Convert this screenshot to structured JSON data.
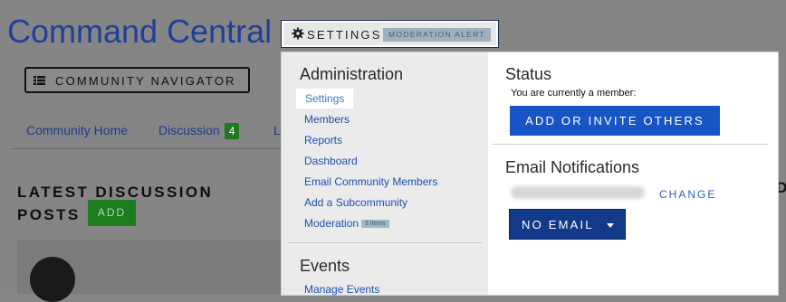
{
  "header": {
    "title": "Command Central"
  },
  "settings_button": {
    "label": "SETTINGS",
    "alert": "MODERATION ALERT",
    "icon": "gear-icon"
  },
  "navigator": {
    "label": "COMMUNITY NAVIGATOR",
    "icon": "list-icon"
  },
  "tabs": [
    {
      "label": "Community Home"
    },
    {
      "label": "Discussion",
      "count": "4"
    },
    {
      "label": "L"
    }
  ],
  "latest": {
    "title_line1": "LATEST DISCUSSION",
    "title_line2": "POSTS",
    "add_label": "ADD"
  },
  "right_fragment": "D",
  "dropdown": {
    "administration": {
      "heading": "Administration",
      "items": [
        {
          "label": "Settings"
        },
        {
          "label": "Members"
        },
        {
          "label": "Reports"
        },
        {
          "label": "Dashboard"
        },
        {
          "label": "Email Community Members"
        },
        {
          "label": "Add a Subcommunity"
        },
        {
          "label": "Moderation",
          "badge": "3 items"
        }
      ]
    },
    "events": {
      "heading": "Events",
      "items": [
        {
          "label": "Manage Events"
        }
      ]
    },
    "status": {
      "heading": "Status",
      "text": "You are currently a member:",
      "button": "ADD OR INVITE OTHERS"
    },
    "email": {
      "heading": "Email Notifications",
      "change": "CHANGE",
      "button": "NO EMAIL"
    }
  },
  "colors": {
    "accent_blue": "#1755c5",
    "green": "#1f7a1f",
    "title_blue": "#1e3f9a"
  }
}
